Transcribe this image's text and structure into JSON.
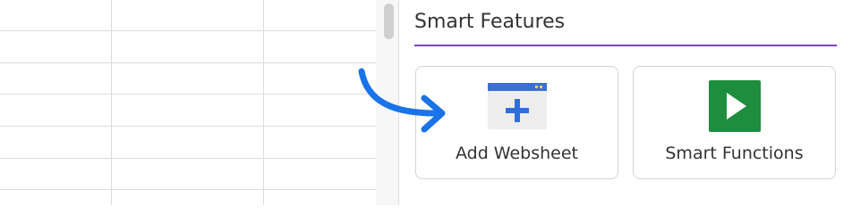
{
  "panel": {
    "title": "Smart Features",
    "accent_color": "#7d3fd1"
  },
  "cards": [
    {
      "label": "Add Websheet",
      "icon": "add-websheet-icon"
    },
    {
      "label": "Smart Functions",
      "icon": "play-icon"
    }
  ],
  "colors": {
    "arrow": "#1a73e8",
    "websheet_bar": "#3b6fd6",
    "websheet_plus": "#2f6fd8",
    "play_bg": "#1e8e3e"
  }
}
